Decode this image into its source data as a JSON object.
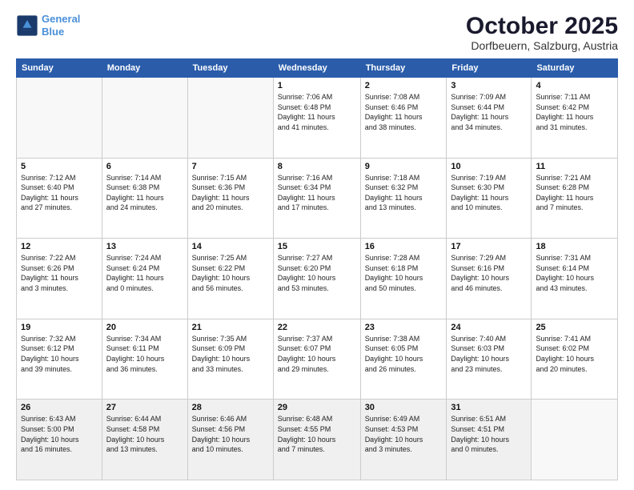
{
  "header": {
    "logo_line1": "General",
    "logo_line2": "Blue",
    "title": "October 2025",
    "subtitle": "Dorfbeuern, Salzburg, Austria"
  },
  "weekdays": [
    "Sunday",
    "Monday",
    "Tuesday",
    "Wednesday",
    "Thursday",
    "Friday",
    "Saturday"
  ],
  "weeks": [
    [
      {
        "day": "",
        "info": ""
      },
      {
        "day": "",
        "info": ""
      },
      {
        "day": "",
        "info": ""
      },
      {
        "day": "1",
        "info": "Sunrise: 7:06 AM\nSunset: 6:48 PM\nDaylight: 11 hours\nand 41 minutes."
      },
      {
        "day": "2",
        "info": "Sunrise: 7:08 AM\nSunset: 6:46 PM\nDaylight: 11 hours\nand 38 minutes."
      },
      {
        "day": "3",
        "info": "Sunrise: 7:09 AM\nSunset: 6:44 PM\nDaylight: 11 hours\nand 34 minutes."
      },
      {
        "day": "4",
        "info": "Sunrise: 7:11 AM\nSunset: 6:42 PM\nDaylight: 11 hours\nand 31 minutes."
      }
    ],
    [
      {
        "day": "5",
        "info": "Sunrise: 7:12 AM\nSunset: 6:40 PM\nDaylight: 11 hours\nand 27 minutes."
      },
      {
        "day": "6",
        "info": "Sunrise: 7:14 AM\nSunset: 6:38 PM\nDaylight: 11 hours\nand 24 minutes."
      },
      {
        "day": "7",
        "info": "Sunrise: 7:15 AM\nSunset: 6:36 PM\nDaylight: 11 hours\nand 20 minutes."
      },
      {
        "day": "8",
        "info": "Sunrise: 7:16 AM\nSunset: 6:34 PM\nDaylight: 11 hours\nand 17 minutes."
      },
      {
        "day": "9",
        "info": "Sunrise: 7:18 AM\nSunset: 6:32 PM\nDaylight: 11 hours\nand 13 minutes."
      },
      {
        "day": "10",
        "info": "Sunrise: 7:19 AM\nSunset: 6:30 PM\nDaylight: 11 hours\nand 10 minutes."
      },
      {
        "day": "11",
        "info": "Sunrise: 7:21 AM\nSunset: 6:28 PM\nDaylight: 11 hours\nand 7 minutes."
      }
    ],
    [
      {
        "day": "12",
        "info": "Sunrise: 7:22 AM\nSunset: 6:26 PM\nDaylight: 11 hours\nand 3 minutes."
      },
      {
        "day": "13",
        "info": "Sunrise: 7:24 AM\nSunset: 6:24 PM\nDaylight: 11 hours\nand 0 minutes."
      },
      {
        "day": "14",
        "info": "Sunrise: 7:25 AM\nSunset: 6:22 PM\nDaylight: 10 hours\nand 56 minutes."
      },
      {
        "day": "15",
        "info": "Sunrise: 7:27 AM\nSunset: 6:20 PM\nDaylight: 10 hours\nand 53 minutes."
      },
      {
        "day": "16",
        "info": "Sunrise: 7:28 AM\nSunset: 6:18 PM\nDaylight: 10 hours\nand 50 minutes."
      },
      {
        "day": "17",
        "info": "Sunrise: 7:29 AM\nSunset: 6:16 PM\nDaylight: 10 hours\nand 46 minutes."
      },
      {
        "day": "18",
        "info": "Sunrise: 7:31 AM\nSunset: 6:14 PM\nDaylight: 10 hours\nand 43 minutes."
      }
    ],
    [
      {
        "day": "19",
        "info": "Sunrise: 7:32 AM\nSunset: 6:12 PM\nDaylight: 10 hours\nand 39 minutes."
      },
      {
        "day": "20",
        "info": "Sunrise: 7:34 AM\nSunset: 6:11 PM\nDaylight: 10 hours\nand 36 minutes."
      },
      {
        "day": "21",
        "info": "Sunrise: 7:35 AM\nSunset: 6:09 PM\nDaylight: 10 hours\nand 33 minutes."
      },
      {
        "day": "22",
        "info": "Sunrise: 7:37 AM\nSunset: 6:07 PM\nDaylight: 10 hours\nand 29 minutes."
      },
      {
        "day": "23",
        "info": "Sunrise: 7:38 AM\nSunset: 6:05 PM\nDaylight: 10 hours\nand 26 minutes."
      },
      {
        "day": "24",
        "info": "Sunrise: 7:40 AM\nSunset: 6:03 PM\nDaylight: 10 hours\nand 23 minutes."
      },
      {
        "day": "25",
        "info": "Sunrise: 7:41 AM\nSunset: 6:02 PM\nDaylight: 10 hours\nand 20 minutes."
      }
    ],
    [
      {
        "day": "26",
        "info": "Sunrise: 6:43 AM\nSunset: 5:00 PM\nDaylight: 10 hours\nand 16 minutes."
      },
      {
        "day": "27",
        "info": "Sunrise: 6:44 AM\nSunset: 4:58 PM\nDaylight: 10 hours\nand 13 minutes."
      },
      {
        "day": "28",
        "info": "Sunrise: 6:46 AM\nSunset: 4:56 PM\nDaylight: 10 hours\nand 10 minutes."
      },
      {
        "day": "29",
        "info": "Sunrise: 6:48 AM\nSunset: 4:55 PM\nDaylight: 10 hours\nand 7 minutes."
      },
      {
        "day": "30",
        "info": "Sunrise: 6:49 AM\nSunset: 4:53 PM\nDaylight: 10 hours\nand 3 minutes."
      },
      {
        "day": "31",
        "info": "Sunrise: 6:51 AM\nSunset: 4:51 PM\nDaylight: 10 hours\nand 0 minutes."
      },
      {
        "day": "",
        "info": ""
      }
    ]
  ]
}
